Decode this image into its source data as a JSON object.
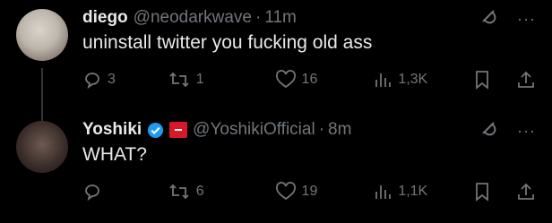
{
  "tweets": [
    {
      "name": "diego",
      "handle": "@neodarkwave",
      "separator": "·",
      "time": "11m",
      "text": "uninstall twitter you fucking old ass",
      "counts": {
        "reply": "3",
        "retweet": "1",
        "like": "16",
        "views": "1,3K"
      }
    },
    {
      "name": "Yoshiki",
      "handle": "@YoshikiOfficial",
      "separator": "·",
      "time": "8m",
      "text": "WHAT?",
      "counts": {
        "reply": "",
        "retweet": "6",
        "like": "19",
        "views": "1,1K"
      }
    }
  ],
  "colors": {
    "background": "#000000",
    "text": "#e7e9ea",
    "muted": "#71767b",
    "verified": "#1d9bf0",
    "affiliate_badge": "#d7192a"
  },
  "icons": [
    "grok-icon",
    "more-icon",
    "reply-icon",
    "retweet-icon",
    "like-icon",
    "views-icon",
    "bookmark-icon",
    "share-icon",
    "verified-badge-icon",
    "affiliate-badge-icon"
  ]
}
